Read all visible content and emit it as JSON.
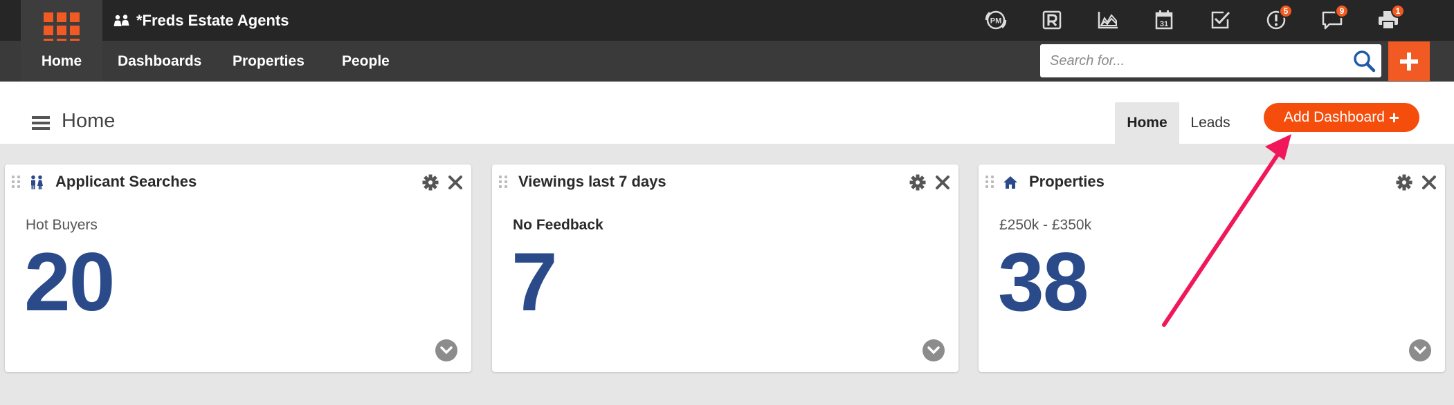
{
  "org": {
    "name": "*Freds Estate Agents"
  },
  "topbar": {
    "icons": [
      {
        "name": "pm-icon",
        "badge": ""
      },
      {
        "name": "r-icon",
        "badge": ""
      },
      {
        "name": "chart-icon",
        "badge": ""
      },
      {
        "name": "calendar-icon",
        "badge": ""
      },
      {
        "name": "checkbox-icon",
        "badge": ""
      },
      {
        "name": "alert-icon",
        "badge": "5"
      },
      {
        "name": "chat-icon",
        "badge": "9"
      },
      {
        "name": "printer-icon",
        "badge": "1"
      }
    ],
    "pm_label": "PM",
    "calendar_day": "31"
  },
  "nav": {
    "home": "Home",
    "dashboards": "Dashboards",
    "properties": "Properties",
    "people": "People"
  },
  "search": {
    "placeholder": "Search for..."
  },
  "header": {
    "title": "Home",
    "tab_home": "Home",
    "tab_leads": "Leads",
    "add_dashboard": "Add Dashboard"
  },
  "colors": {
    "accent": "#f15a22",
    "value_blue": "#2a4a8a",
    "topbar": "#262626",
    "navbar": "#3a3a3a"
  },
  "cards": [
    {
      "title": "Applicant Searches",
      "icon": "people-icon",
      "subtitle": "Hot Buyers",
      "value": "20"
    },
    {
      "title": "Viewings last 7 days",
      "icon": "",
      "subtitle": "No Feedback",
      "value": "7"
    },
    {
      "title": "Properties",
      "icon": "house-icon",
      "subtitle": "£250k - £350k",
      "value": "38"
    }
  ]
}
